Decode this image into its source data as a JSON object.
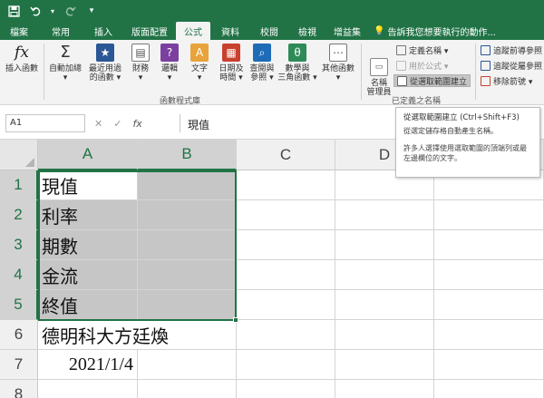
{
  "qat": {
    "save_icon": "save-icon",
    "undo_icon": "undo-icon",
    "redo_icon": "redo-icon",
    "customize_icon": "customize-icon"
  },
  "tabs": [
    {
      "label": "檔案",
      "active": false
    },
    {
      "label": "常用",
      "active": false
    },
    {
      "label": "插入",
      "active": false
    },
    {
      "label": "版面配置",
      "active": false
    },
    {
      "label": "公式",
      "active": true
    },
    {
      "label": "資料",
      "active": false
    },
    {
      "label": "校閱",
      "active": false
    },
    {
      "label": "檢視",
      "active": false
    },
    {
      "label": "增益集",
      "active": false
    }
  ],
  "tellme": "告訴我您想要執行的動作...",
  "ribbon": {
    "insert_function": {
      "line1": "插入函數",
      "line2": ""
    },
    "autosum": {
      "line1": "自動加總",
      "line2": "▾"
    },
    "recent": {
      "line1": "最近用過",
      "line2": "的函數 ▾"
    },
    "financial": {
      "line1": "財務",
      "line2": "▾"
    },
    "logical": {
      "line1": "邏輯",
      "line2": "▾"
    },
    "text": {
      "line1": "文字",
      "line2": "▾"
    },
    "datetime": {
      "line1": "日期及",
      "line2": "時間 ▾"
    },
    "lookup": {
      "line1": "查閱與",
      "line2": "參照 ▾"
    },
    "math": {
      "line1": "數學與",
      "line2": "三角函數 ▾"
    },
    "more": {
      "line1": "其他函數",
      "line2": "▾"
    },
    "library_label": "函數程式庫",
    "name_manager": {
      "line1": "名稱",
      "line2": "管理員"
    },
    "define_name": "定義名稱 ▾",
    "use_in_formula": "用於公式 ▾",
    "create_from_selection": "從選取範圍建立",
    "defined_names_label": "已定義之名稱",
    "trace_precedents": "追蹤前導參照",
    "trace_dependents": "追蹤從屬參照",
    "remove_arrows": "移除箭號 ▾"
  },
  "formula_bar": {
    "name_box": "A1",
    "cancel_icon": "✕",
    "enter_icon": "✓",
    "fx": "fx",
    "value": "現值"
  },
  "tooltip": {
    "title": "從選取範圍建立 (Ctrl+Shift+F3)",
    "p1": "從選定儲存格自動產生名稱。",
    "p2": "許多人選擇使用選取範圍的頂端列或最左邊欄位的文字。"
  },
  "columns": [
    "A",
    "B",
    "C",
    "D"
  ],
  "rows": [
    "1",
    "2",
    "3",
    "4",
    "5",
    "6",
    "7",
    "8"
  ],
  "cells": {
    "A1": "現值",
    "A2": "利率",
    "A3": "期數",
    "A4": "金流",
    "A5": "終值",
    "A6": "德明科大方廷煥",
    "A7": "2021/1/4"
  },
  "colors": {
    "accent": "#217346",
    "selection_fill": "#c6c6c6"
  }
}
